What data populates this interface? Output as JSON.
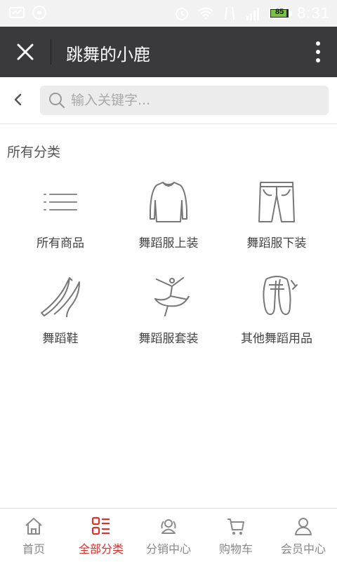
{
  "status_bar": {
    "battery_level": "85",
    "time": "8:31",
    "icons": [
      "message-icon",
      "sync-icon",
      "alarm-icon",
      "wifi-icon",
      "data-icon",
      "signal-icon",
      "battery-icon"
    ]
  },
  "titlebar": {
    "title": "跳舞的小鹿",
    "close_icon": "close-icon",
    "more_icon": "more-vertical-icon"
  },
  "search": {
    "placeholder": "输入关键字...",
    "value": ""
  },
  "section": {
    "title": "所有分类"
  },
  "categories": [
    {
      "label": "所有商品",
      "icon": "list-icon"
    },
    {
      "label": "舞蹈服上装",
      "icon": "top-garment-icon"
    },
    {
      "label": "舞蹈服下装",
      "icon": "pants-icon"
    },
    {
      "label": "舞蹈鞋",
      "icon": "dance-shoe-icon"
    },
    {
      "label": "舞蹈服套装",
      "icon": "dancer-icon"
    },
    {
      "label": "其他舞蹈用品",
      "icon": "ballet-shoes-icon"
    }
  ],
  "bottom_nav": [
    {
      "label": "首页",
      "icon": "home-icon",
      "active": false
    },
    {
      "label": "全部分类",
      "icon": "categories-icon",
      "active": true
    },
    {
      "label": "分销中心",
      "icon": "users-icon",
      "active": false
    },
    {
      "label": "购物车",
      "icon": "cart-icon",
      "active": false
    },
    {
      "label": "会员中心",
      "icon": "user-icon",
      "active": false
    }
  ],
  "colors": {
    "titlebar_bg": "#3a3a3c",
    "accent": "#e0302b",
    "icon_gray": "#8a8a8a"
  }
}
